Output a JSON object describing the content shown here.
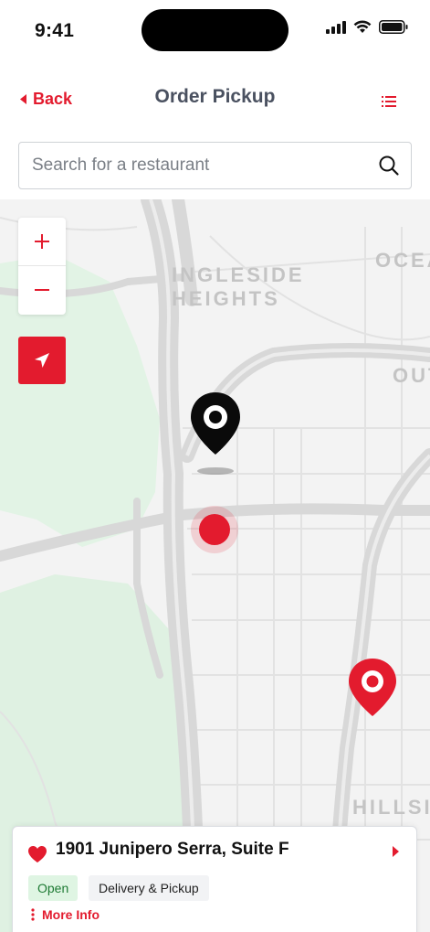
{
  "status_bar": {
    "time": "9:41"
  },
  "nav": {
    "back_label": "Back",
    "title": "Order Pickup"
  },
  "search": {
    "placeholder": "Search for a restaurant",
    "value": ""
  },
  "map": {
    "labels": [
      "INGLESIDE",
      "HEIGHTS",
      "OCEA",
      "OUT",
      "HILLSI"
    ],
    "controls": {
      "zoom_in": "+",
      "zoom_out": "−"
    }
  },
  "location_card": {
    "address": "1901 Junipero Serra, Suite F",
    "status": "Open",
    "service": "Delivery & Pickup",
    "more_info": "More Info"
  },
  "colors": {
    "accent": "#e31b2e",
    "open_green": "#1e7a34",
    "open_bg": "#dff5e3",
    "title_gray": "#4a5160"
  },
  "icons": [
    "signal-icon",
    "wifi-icon",
    "battery-icon",
    "back-chevron-icon",
    "list-icon",
    "search-icon",
    "plus-icon",
    "minus-icon",
    "locate-arrow-icon",
    "map-pin-icon",
    "user-location-icon",
    "heart-icon",
    "chevron-right-icon",
    "more-vertical-icon"
  ]
}
